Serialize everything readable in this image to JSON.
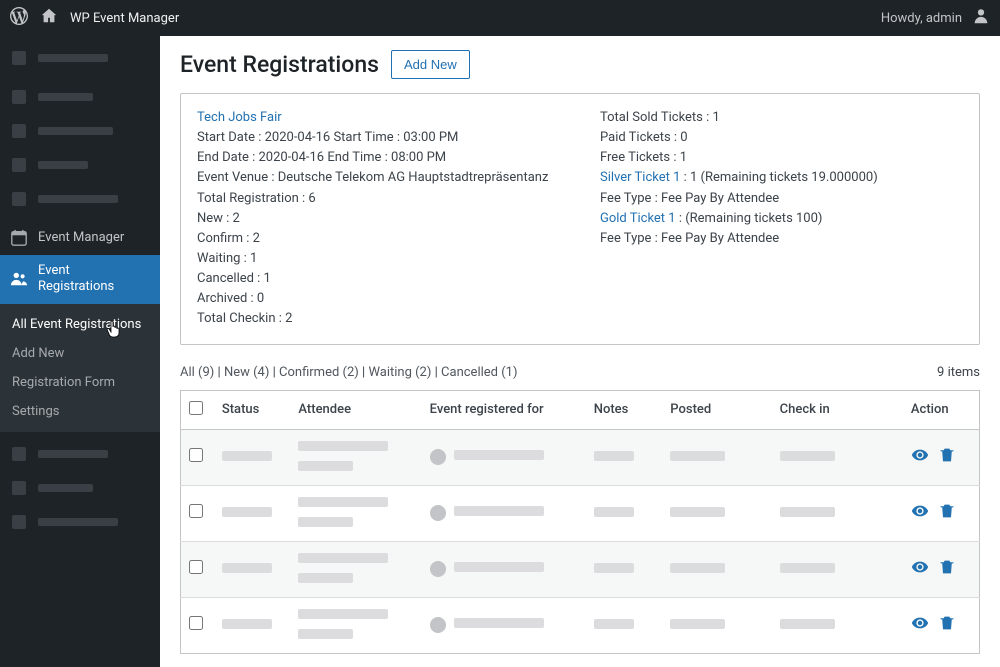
{
  "adminbar": {
    "site_title": "WP Event Manager",
    "howdy": "Howdy, admin"
  },
  "sidebar": {
    "event_manager": "Event Manager",
    "event_registrations": "Event\nRegistrations",
    "sub": {
      "all": "All Event Registrations",
      "add_new": "Add New",
      "reg_form": "Registration Form",
      "settings": "Settings"
    }
  },
  "page": {
    "title": "Event Registrations",
    "add_new_btn": "Add New"
  },
  "event": {
    "name": "Tech Jobs Fair",
    "start": "Start Date : 2020-04-16 Start Time : 03:00 PM",
    "end": "End Date : 2020-04-16 End Time : 08:00 PM",
    "venue": "Event Venue : Deutsche Telekom AG Hauptstadtrepräsentanz",
    "total_reg": "Total Registration : 6",
    "new": "New : 2",
    "confirm": "Confirm : 2",
    "waiting": "Waiting : 1",
    "cancelled": "Cancelled : 1",
    "archived": "Archived : 0",
    "total_checkin": "Total Checkin : 2",
    "sold": "Total Sold Tickets : 1",
    "paid": "Paid Tickets : 0",
    "free": "Free Tickets : 1",
    "silver_label": "Silver Ticket 1",
    "silver_rest": " : 1 (Remaining tickets 19.000000)",
    "fee1": "Fee Type : Fee Pay By Attendee",
    "gold_label": "Gold Ticket 1",
    "gold_rest": " : (Remaining tickets 100)",
    "fee2": "Fee Type : Fee Pay By Attendee"
  },
  "filters": {
    "all": "All (9)",
    "new": "New (4)",
    "confirmed": "Confirmed (2)",
    "waiting": "Waiting (2)",
    "cancelled": "Cancelled (1)",
    "total_items": "9 items"
  },
  "table": {
    "headers": {
      "status": "Status",
      "attendee": "Attendee",
      "event_for": "Event registered for",
      "notes": "Notes",
      "posted": "Posted",
      "checkin": "Check in",
      "action": "Action"
    }
  },
  "colors": {
    "accent": "#2271b1"
  }
}
